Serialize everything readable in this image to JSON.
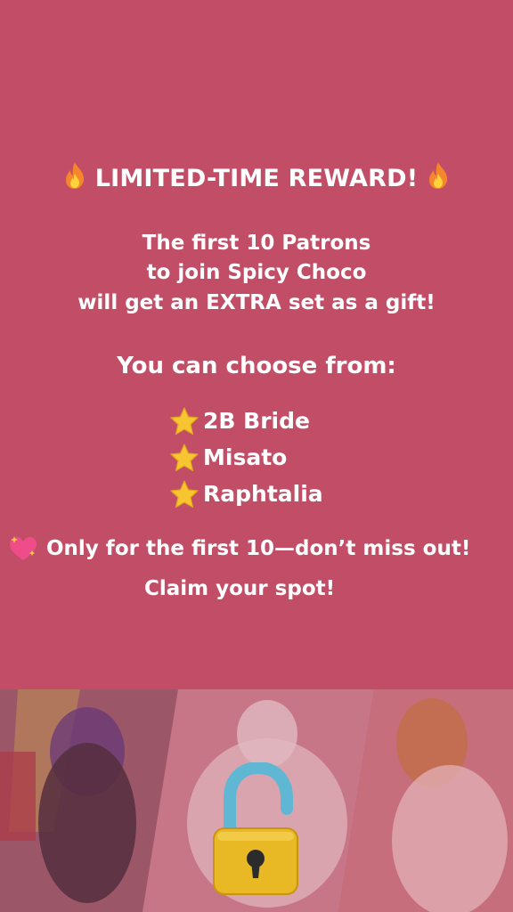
{
  "headline": "LIMITED-TIME REWARD!",
  "intro": {
    "line1": "The first 10 Patrons",
    "line2": "to join Spicy Choco",
    "line3": "will get an EXTRA set as a gift!"
  },
  "choose_label": "You can choose from:",
  "options": [
    "2B Bride",
    "Misato",
    "Raphtalia"
  ],
  "warning": "Only for the first 10—don’t miss out!",
  "claim": "Claim your spot!",
  "icons": {
    "title_left": "fire-icon",
    "title_right": "fire-icon",
    "option_bullet": "star-icon",
    "warning_prefix": "sparkling-heart-icon",
    "overlay": "unlocked-padlock-icon"
  },
  "colors": {
    "background": "#c14e66",
    "text": "#ffffff",
    "star": "#f7c531",
    "padlock_body": "#e9b825",
    "padlock_shackle": "#5fb7d4"
  }
}
